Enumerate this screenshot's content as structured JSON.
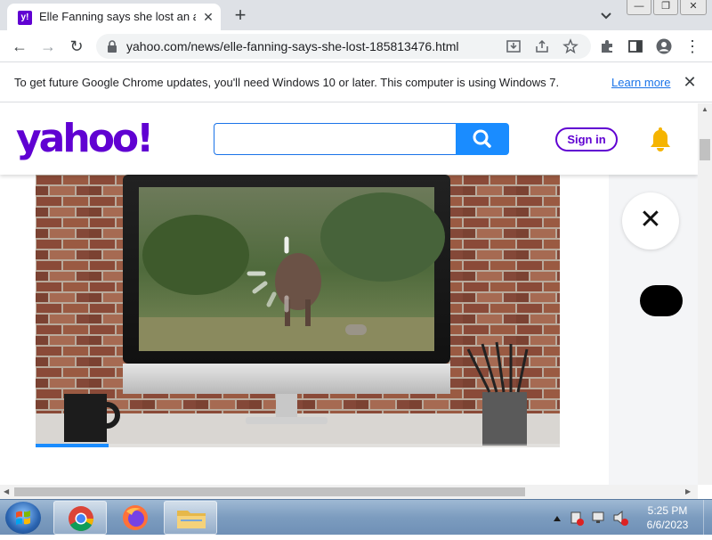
{
  "browser": {
    "tab": {
      "title": "Elle Fanning says she lost an acti",
      "favicon_text": "y!",
      "close_glyph": "✕"
    },
    "new_tab_glyph": "+",
    "window_controls": {
      "minimize": "—",
      "maximize": "❐",
      "close": "✕"
    },
    "toolbar": {
      "back_glyph": "←",
      "forward_glyph": "→",
      "reload_glyph": "↻",
      "url": "yahoo.com/news/elle-fanning-says-she-lost-185813476.html",
      "menu_glyph": "⋮"
    },
    "infobar": {
      "message": "To get future Google Chrome updates, you'll need Windows 10 or later. This computer is using Windows 7.",
      "learn_more": "Learn more",
      "close_glyph": "✕"
    }
  },
  "page": {
    "logo_text": "yahoo!",
    "search": {
      "value": "",
      "placeholder": ""
    },
    "signin_label": "Sign in",
    "close_overlay_glyph": "✕",
    "video": {
      "progress_fraction": 0.14
    }
  },
  "taskbar": {
    "time": "5:25 PM",
    "date": "6/6/2023"
  },
  "colors": {
    "yahoo_purple": "#6001d2",
    "search_blue": "#1a8cff",
    "link_blue": "#1a73e8",
    "bell_yellow": "#f5b400"
  }
}
